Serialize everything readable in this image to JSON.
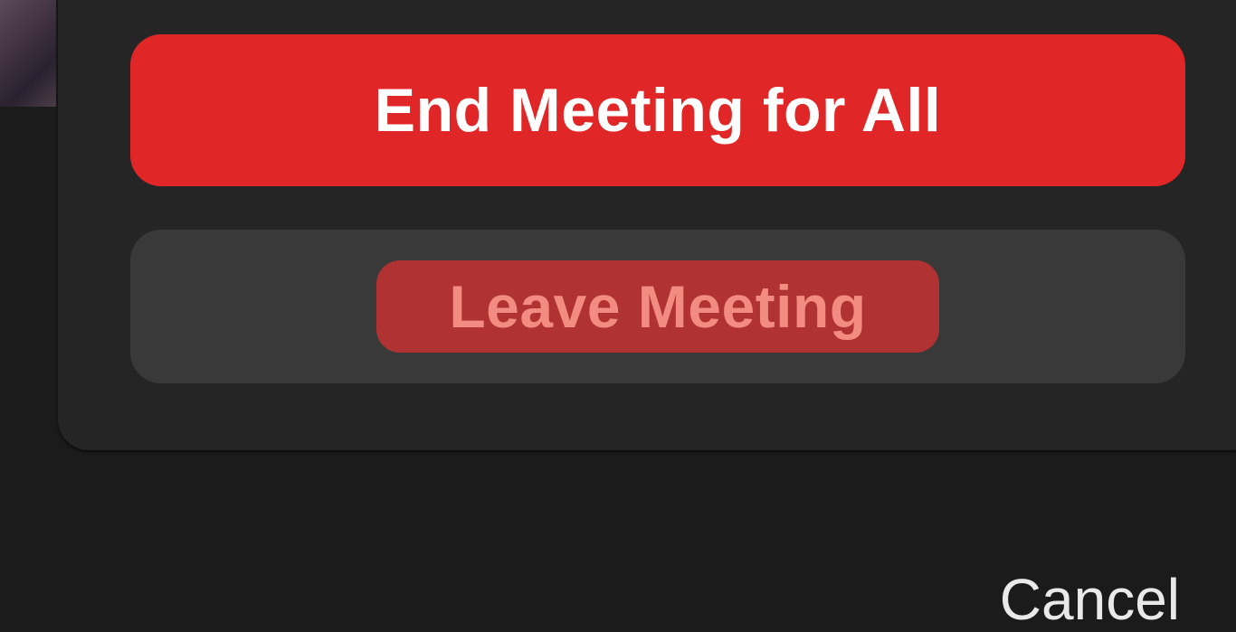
{
  "dialog": {
    "end_for_all_label": "End Meeting for All",
    "leave_label": "Leave Meeting",
    "cancel_label": "Cancel"
  },
  "colors": {
    "end_button": "#e02626",
    "leave_button_bg": "#393939",
    "leave_highlight": "#b13232",
    "leave_text": "#f28b82",
    "panel": "#252525",
    "background": "#1b1b1b"
  }
}
